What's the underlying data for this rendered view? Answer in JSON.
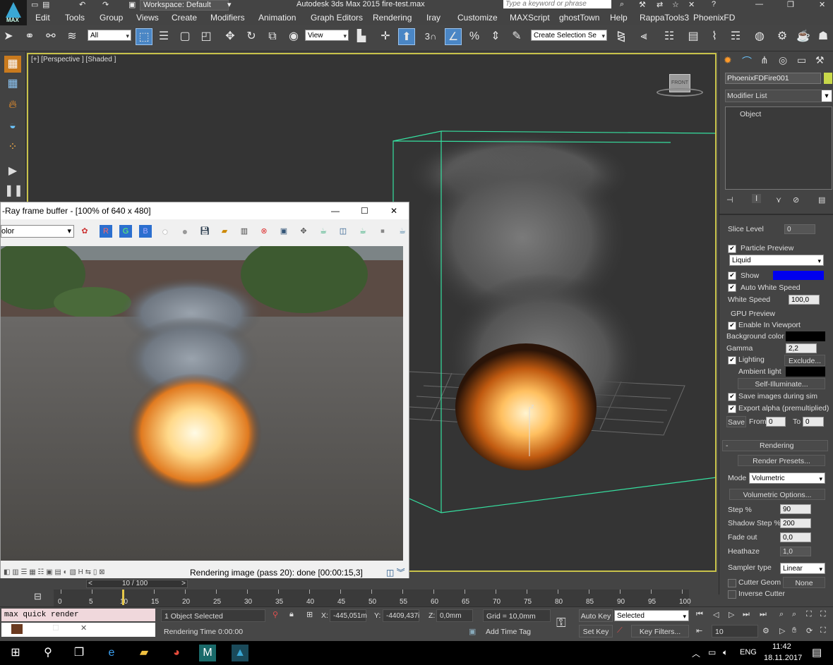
{
  "app": {
    "title": "Autodesk 3ds Max  2015     fire-test.max",
    "workspace": "Workspace: Default",
    "search_placeholder": "Type a keyword or phrase",
    "logo_label": "MAX"
  },
  "menu": [
    "Edit",
    "Tools",
    "Group",
    "Views",
    "Create",
    "Modifiers",
    "Animation",
    "Graph Editors",
    "Rendering",
    "Iray",
    "Customize",
    "MAXScript",
    "ghostTown",
    "Help",
    "RappaTools3",
    "PhoenixFD"
  ],
  "toolbar": {
    "filter_select": "All",
    "ref_coord_select": "View",
    "selection_set": "Create Selection Se",
    "snap_label": "3"
  },
  "viewport": {
    "label": "[+] [Perspective ] [Shaded ]",
    "viewcube_label": "FRONT",
    "gizmo_axis": "z"
  },
  "vfb": {
    "title": "V-Ray frame buffer - [100% of 640 x 480]",
    "title_visible": "-Ray frame buffer - [100% of 640 x 480]",
    "channel_select": "olor",
    "btn_r": "R",
    "btn_g": "G",
    "btn_b": "B",
    "status": "Rendering image (pass 20): done [00:00:15,3]",
    "minimize": "—",
    "maximize": "☐",
    "close": "✕"
  },
  "command_panel": {
    "object_name": "PhoenixFDFire001",
    "modifier_list": "Modifier List",
    "stack_item": "Object",
    "slice_level_label": "Slice Level",
    "slice_level_value": "0",
    "particle_preview_label": "Particle Preview",
    "particle_type": "Liquid",
    "show_label": "Show",
    "auto_white_speed_label": "Auto White Speed",
    "white_speed_label": "White Speed",
    "white_speed_value": "100,0",
    "gpu_preview_label": "GPU Preview",
    "enable_in_viewport_label": "Enable In Viewport",
    "background_color_label": "Background color",
    "gamma_label": "Gamma",
    "gamma_value": "2,2",
    "lighting_label": "Lighting",
    "exclude_button": "Exclude...",
    "ambient_light_label": "Ambient light",
    "self_illuminate_button": "Self-Illuminate...",
    "save_images_label": "Save images during sim",
    "export_alpha_label": "Export alpha (premultiplied)",
    "save_button": "Save",
    "from_label": "From",
    "from_value": "0",
    "to_label": "To",
    "to_value": "0",
    "rendering_rollout": "Rendering",
    "rollout_toggle": "-",
    "render_presets_button": "Render Presets...",
    "mode_label": "Mode",
    "mode_value": "Volumetric",
    "volumetric_options_button": "Volumetric Options...",
    "step_label": "Step %",
    "step_value": "90",
    "shadow_step_label": "Shadow Step %",
    "shadow_step_value": "200",
    "fade_out_label": "Fade out",
    "fade_out_value": "0,0",
    "heathaze_label": "Heathaze",
    "heathaze_value": "1,0",
    "sampler_type_label": "Sampler type",
    "sampler_type_value": "Linear",
    "cutter_geom_label": "Cutter Geom",
    "cutter_geom_value": "None",
    "inverse_cutter_label": "Inverse Cutter",
    "colors": {
      "show_swatch": "#0000ee",
      "background_swatch": "#000000",
      "ambient_swatch": "#000000"
    }
  },
  "timeline": {
    "frame_counter": "10 / 100",
    "prev_arrow": "<",
    "next_arrow": ">",
    "ticks": [
      "0",
      "5",
      "10",
      "15",
      "20",
      "25",
      "30",
      "35",
      "40",
      "45",
      "50",
      "55",
      "60",
      "65",
      "70",
      "75",
      "80",
      "85",
      "90",
      "95",
      "100"
    ]
  },
  "status": {
    "maxscript_text": "max quick render",
    "selection_text": "1 Object Selected",
    "rendering_time": "Rendering Time  0:00:00",
    "x_label": "X:",
    "x_value": "-445,051m",
    "y_label": "Y:",
    "y_value": "-4409,437i",
    "z_label": "Z:",
    "z_value": "0,0mm",
    "grid": "Grid = 10,0mm",
    "add_time_tag": "Add Time Tag",
    "auto_key": "Auto Key",
    "set_key": "Set Key",
    "selected_dropdown": "Selected",
    "key_filters": "Key Filters...",
    "frame_field": "10"
  },
  "taskbar": {
    "language": "ENG",
    "time": "11:42",
    "date": "18.11.2017"
  }
}
